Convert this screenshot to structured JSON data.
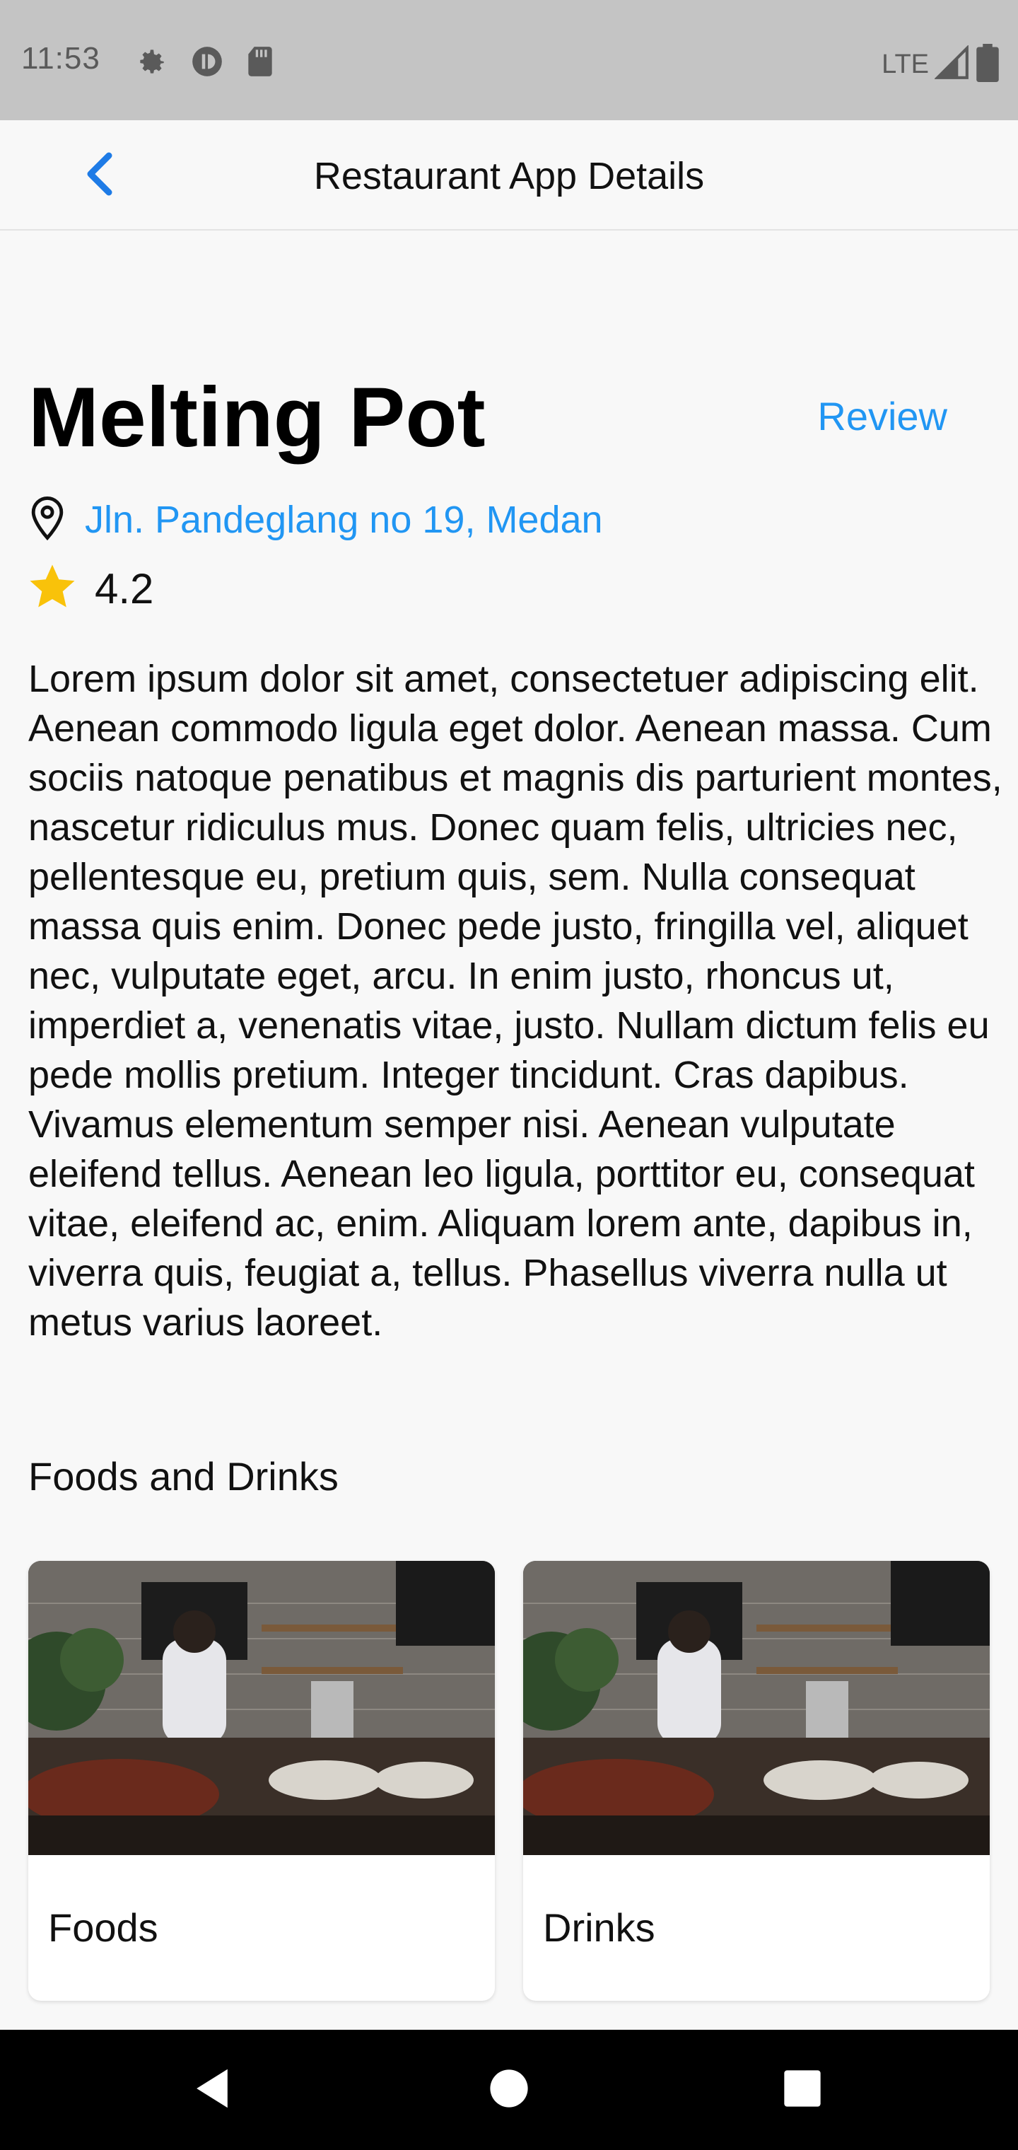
{
  "status_bar": {
    "time": "11:53",
    "network": "LTE",
    "icons_left": [
      "settings-icon",
      "data-saver-icon",
      "sd-card-icon"
    ],
    "icons_right": [
      "signal-icon",
      "battery-icon"
    ]
  },
  "app_bar": {
    "back_icon": "chevron-left-icon",
    "title": "Restaurant App Details"
  },
  "restaurant": {
    "name": "Melting Pot",
    "review_label": "Review",
    "address": "Jln. Pandeglang no 19, Medan",
    "rating": "4.2",
    "description": "Lorem ipsum dolor sit amet, consectetuer adipiscing elit. Aenean commodo ligula eget dolor. Aenean massa. Cum sociis natoque penatibus et magnis dis parturient montes, nascetur ridiculus mus. Donec quam felis, ultricies nec, pellentesque eu, pretium quis, sem. Nulla consequat massa quis enim. Donec pede justo, fringilla vel, aliquet nec, vulputate eget, arcu. In enim justo, rhoncus ut, imperdiet a, venenatis vitae, justo. Nullam dictum felis eu pede mollis pretium. Integer tincidunt. Cras dapibus. Vivamus elementum semper nisi. Aenean vulputate eleifend tellus. Aenean leo ligula, porttitor eu, consequat vitae, eleifend ac, enim. Aliquam lorem ante, dapibus in, viverra quis, feugiat a, tellus. Phasellus viverra nulla ut metus varius laoreet."
  },
  "menu_section": {
    "title": "Foods and Drinks",
    "cards": [
      {
        "label": "Foods"
      },
      {
        "label": "Drinks"
      }
    ]
  },
  "colors": {
    "accent": "#2196f3",
    "star": "#f9c20a",
    "status_bar_bg": "#c4c4c4",
    "nav_bar_bg": "#000000"
  },
  "nav_bar": {
    "icons": [
      "back-triangle-icon",
      "home-circle-icon",
      "recents-square-icon"
    ]
  }
}
